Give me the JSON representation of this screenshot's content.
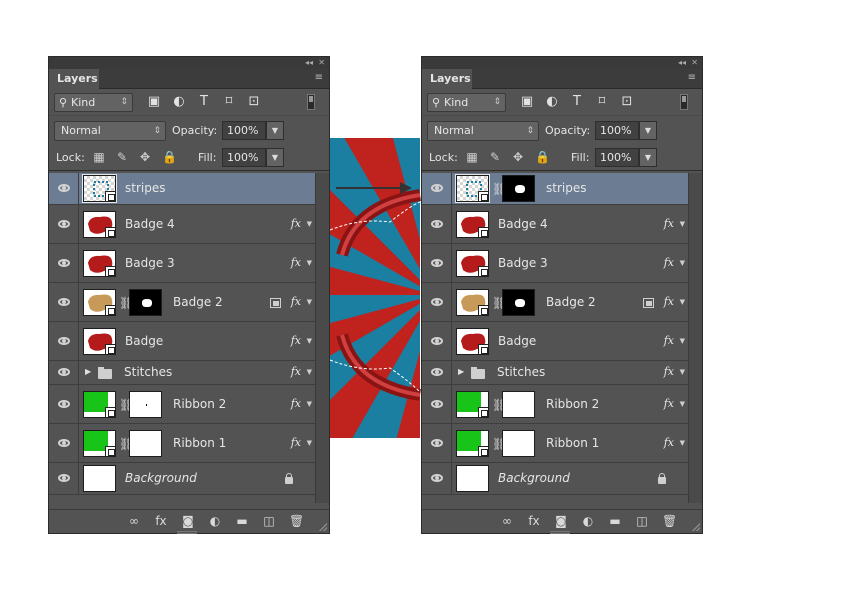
{
  "panels": [
    {
      "id": "left",
      "tab": "Layers",
      "kind_label": "Kind",
      "blend_mode": "Normal",
      "opacity_label": "Opacity:",
      "opacity": "100%",
      "lock_label": "Lock:",
      "fill_label": "Fill:",
      "fill": "100%",
      "layers": [
        {
          "name": "stripes",
          "type": "smart",
          "selected": true,
          "thumb": "stripes",
          "mask": false,
          "fx": false
        },
        {
          "name": "Badge 4",
          "type": "smart",
          "thumb": "red",
          "mask": false,
          "fx": true
        },
        {
          "name": "Badge 3",
          "type": "smart",
          "thumb": "red",
          "mask": false,
          "fx": true
        },
        {
          "name": "Badge 2",
          "type": "smart",
          "thumb": "tan",
          "mask": true,
          "mask_style": "black-blob",
          "fx": true,
          "filter_badge": true
        },
        {
          "name": "Badge",
          "type": "smart",
          "thumb": "red",
          "mask": false,
          "fx": true
        },
        {
          "name": "Stitches",
          "type": "group",
          "fx": true
        },
        {
          "name": "Ribbon 2",
          "type": "smart",
          "thumb": "green",
          "mask": true,
          "mask_style": "white-dot",
          "fx": true
        },
        {
          "name": "Ribbon 1",
          "type": "smart",
          "thumb": "green",
          "mask": true,
          "mask_style": "white",
          "fx": true
        },
        {
          "name": "Background",
          "type": "background",
          "thumb": "white",
          "locked": true
        }
      ]
    },
    {
      "id": "right",
      "tab": "Layers",
      "kind_label": "Kind",
      "blend_mode": "Normal",
      "opacity_label": "Opacity:",
      "opacity": "100%",
      "lock_label": "Lock:",
      "fill_label": "Fill:",
      "fill": "100%",
      "layers": [
        {
          "name": "stripes",
          "type": "smart",
          "selected": true,
          "thumb": "stripes",
          "mask": true,
          "mask_style": "black-blob",
          "fx": false
        },
        {
          "name": "Badge 4",
          "type": "smart",
          "thumb": "red",
          "mask": false,
          "fx": true
        },
        {
          "name": "Badge 3",
          "type": "smart",
          "thumb": "red",
          "mask": false,
          "fx": true
        },
        {
          "name": "Badge 2",
          "type": "smart",
          "thumb": "tan",
          "mask": true,
          "mask_style": "black-blob",
          "fx": true,
          "filter_badge": true
        },
        {
          "name": "Badge",
          "type": "smart",
          "thumb": "red",
          "mask": false,
          "fx": true
        },
        {
          "name": "Stitches",
          "type": "group",
          "fx": true
        },
        {
          "name": "Ribbon 2",
          "type": "smart",
          "thumb": "green",
          "mask": true,
          "mask_style": "white",
          "fx": true
        },
        {
          "name": "Ribbon 1",
          "type": "smart",
          "thumb": "green",
          "mask": true,
          "mask_style": "white",
          "fx": true
        },
        {
          "name": "Background",
          "type": "background",
          "thumb": "white",
          "locked": true
        }
      ]
    }
  ],
  "icons": {
    "filter": [
      "image-filter-icon",
      "adjustment-filter-icon",
      "type-filter-icon",
      "shape-filter-icon",
      "smart-object-filter-icon"
    ],
    "lock": [
      "lock-transparent-icon",
      "lock-image-icon",
      "lock-position-icon",
      "lock-all-icon"
    ],
    "footer": [
      "link-layers-icon",
      "add-style-icon",
      "add-mask-icon",
      "new-adjustment-icon",
      "new-group-icon",
      "new-layer-icon",
      "delete-layer-icon"
    ]
  },
  "colors": {
    "panel_bg": "#535353",
    "selected_row": "#6c7d93",
    "stripe_blue": "#1a7fa0",
    "stripe_red": "#c0221e",
    "badge_red": "#b51b1b",
    "badge_tan": "#c89a5a",
    "ribbon_green": "#19c419"
  }
}
